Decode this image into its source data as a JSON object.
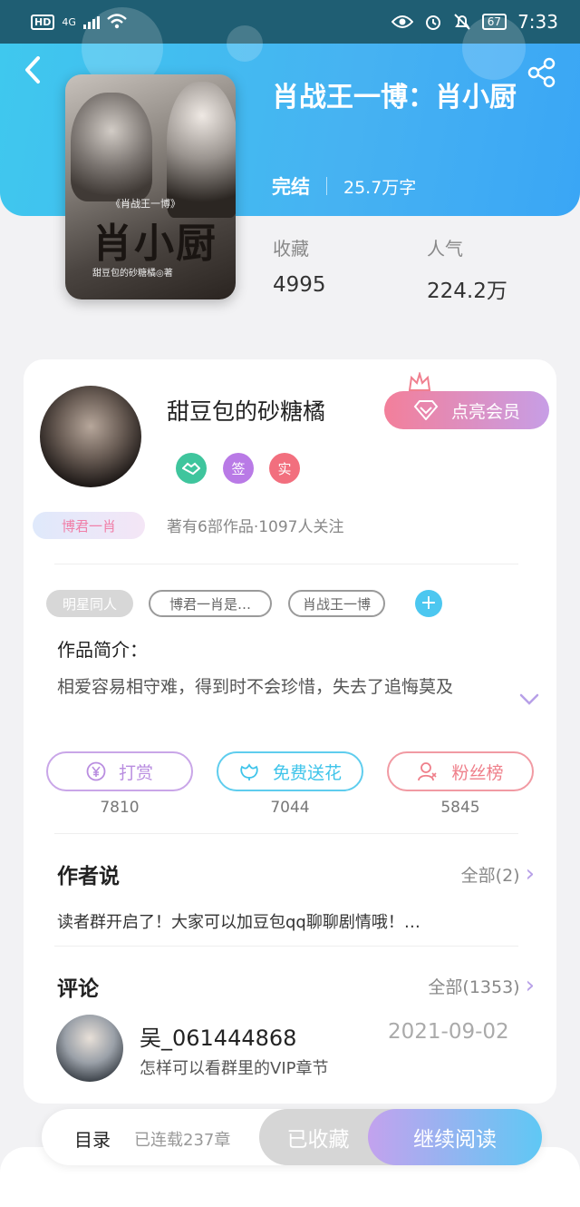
{
  "status_bar": {
    "hd": "HD",
    "network": "4G",
    "battery": "67",
    "time": "7:33"
  },
  "book": {
    "title": "肖战王一博：肖小厨",
    "status": "完结",
    "word_count": "25.7万字",
    "cover": {
      "series": "《肖战王一博》",
      "title": "肖小厨",
      "author_line": "甜豆包的砂糖橘◎著"
    },
    "stats": [
      {
        "label": "收藏",
        "value": "4995"
      },
      {
        "label": "人气",
        "value": "224.2万"
      }
    ]
  },
  "author": {
    "name": "甜豆包的砂糖橘",
    "vip_button": "点亮会员",
    "badges": [
      {
        "icon": "handshake-icon",
        "text": "",
        "color": "#3fc59d"
      },
      {
        "icon": "sign-badge",
        "text": "签",
        "color": "#b97ae6"
      },
      {
        "icon": "verified-badge",
        "text": "实",
        "color": "#f26f7e"
      }
    ],
    "fan_badge": "博君一肖",
    "stats_text": "著有6部作品·1097人关注"
  },
  "tags": [
    "明星同人",
    "博君一肖是…",
    "肖战王一博"
  ],
  "intro": {
    "label": "作品简介：",
    "text": "相爱容易相守难，得到时不会珍惜，失去了追悔莫及"
  },
  "actions": [
    {
      "label": "打赏",
      "icon": "yen-icon",
      "count": "7810",
      "color": "#b98de0"
    },
    {
      "label": "免费送花",
      "icon": "flower-icon",
      "count": "7044",
      "color": "#3ec4ea"
    },
    {
      "label": "粉丝榜",
      "icon": "user-rank-icon",
      "count": "5845",
      "color": "#ef7f8a"
    }
  ],
  "author_says": {
    "title": "作者说",
    "more": "全部(2)",
    "text": "读者群开启了！大家可以加豆包qq聊聊剧情哦！…"
  },
  "comments": {
    "title": "评论",
    "more": "全部(1353)",
    "items": [
      {
        "user": "吴_061444868",
        "date": "2021-09-02",
        "text": "怎样可以看群里的VIP章节"
      }
    ]
  },
  "bottom_bar": {
    "toc": "目录",
    "serial": "已连载237章",
    "collected": "已收藏",
    "continue": "继续阅读"
  },
  "colors": {
    "header_gradient_start": "#3fc8ee",
    "header_gradient_end": "#3aa6f5",
    "accent_purple": "#b7a0e8"
  }
}
